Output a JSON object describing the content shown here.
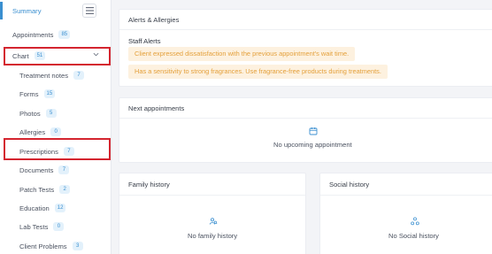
{
  "sidebar": {
    "summary_label": "Summary",
    "items": [
      {
        "label": "Appointments",
        "count": "85"
      },
      {
        "label": "Chart",
        "count": "51"
      },
      {
        "label": "Treatment notes",
        "count": "7"
      },
      {
        "label": "Forms",
        "count": "15"
      },
      {
        "label": "Photos",
        "count": "5"
      },
      {
        "label": "Allergies",
        "count": "0"
      },
      {
        "label": "Prescriptions",
        "count": "7"
      },
      {
        "label": "Documents",
        "count": "7"
      },
      {
        "label": "Patch Tests",
        "count": "2"
      },
      {
        "label": "Education",
        "count": "12"
      },
      {
        "label": "Lab Tests",
        "count": "0"
      },
      {
        "label": "Client Problems",
        "count": "3"
      }
    ]
  },
  "alerts_card": {
    "title": "Alerts & Allergies",
    "staff_alerts_title": "Staff Alerts",
    "alerts": [
      "Client expressed dissatisfaction with the previous appointment's wait time.",
      "Has a sensitivity to strong fragrances. Use fragrance-free products during treatments."
    ]
  },
  "next_appointments": {
    "title": "Next appointments",
    "empty_text": "No upcoming appointment"
  },
  "family_history": {
    "title": "Family history",
    "empty_text": "No family history"
  },
  "social_history": {
    "title": "Social history",
    "empty_text": "No Social history"
  },
  "colors": {
    "accent": "#3a8fd0",
    "badge_bg": "#e3f1fb",
    "alert_bg": "#fdf1df",
    "alert_text": "#e4a03b",
    "highlight": "#d4252f"
  },
  "icons": {
    "summary_toggle": "list-icon",
    "chart_expand": "chevron-down-icon",
    "next_appointments": "calendar-icon",
    "family_history": "family-icon",
    "social_history": "social-icon"
  }
}
